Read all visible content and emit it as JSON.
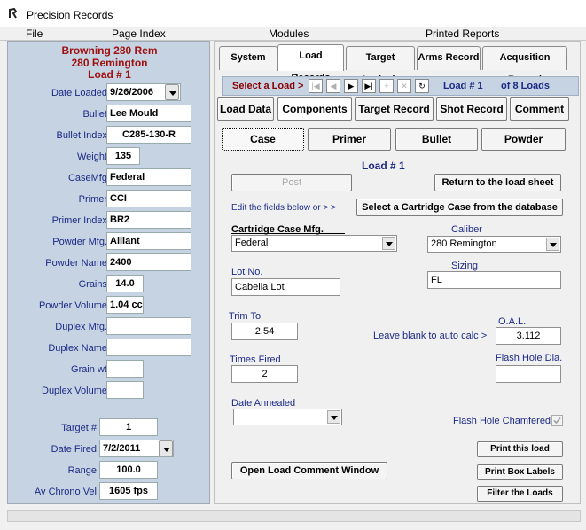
{
  "window": {
    "title": "Precision Records"
  },
  "menu": [
    "File",
    "Page Index",
    "Modules",
    "Printed Reports"
  ],
  "left": {
    "heading1": "Browning 280 Rem",
    "heading2": "280 Remington",
    "heading3": "Load #  1",
    "fields": {
      "date_loaded": {
        "label": "Date Loaded",
        "value": "9/26/2006"
      },
      "bullet": {
        "label": "Bullet",
        "value": "Lee Mould"
      },
      "bullet_index": {
        "label": "Bullet Index",
        "value": "C285-130-R"
      },
      "weight": {
        "label": "Weight",
        "value": "135"
      },
      "casemfg": {
        "label": "CaseMfg",
        "value": "Federal"
      },
      "primer": {
        "label": "Primer",
        "value": "CCI"
      },
      "primer_index": {
        "label": "Primer Index",
        "value": "BR2"
      },
      "powder_mfg": {
        "label": "Powder Mfg.",
        "value": "Alliant"
      },
      "powder_name": {
        "label": "Powder Name",
        "value": "2400"
      },
      "grains": {
        "label": "Grains",
        "value": "14.0"
      },
      "powder_volume": {
        "label": "Powder Volume",
        "value": "1.04 cc"
      },
      "duplex_mfg": {
        "label": "Duplex Mfg.",
        "value": ""
      },
      "duplex_name": {
        "label": "Duplex Name",
        "value": ""
      },
      "grain_wt": {
        "label": "Grain wt",
        "value": ""
      },
      "duplex_volume": {
        "label": "Duplex Volume",
        "value": ""
      },
      "target": {
        "label": "Target #",
        "value": "1"
      },
      "date_fired": {
        "label": "Date Fired",
        "value": "7/2/2011"
      },
      "range": {
        "label": "Range",
        "value": "100.0"
      },
      "av_chrono": {
        "label": "Av Chrono Vel",
        "value": "1605 fps"
      }
    }
  },
  "tabs": [
    "System",
    "Load Records",
    "Target Analysis",
    "Arms Record",
    "Acqusition Record"
  ],
  "select_bar": {
    "label": "Select a Load >",
    "load_text": "Load # 1",
    "of_text": "of 8  Loads",
    "nav": [
      "|◀",
      "◀",
      "▶",
      "▶|",
      "+",
      "✕",
      "↻"
    ]
  },
  "subtabs": [
    "Load Data",
    "Components",
    "Target Record",
    "Shot Record",
    "Comment"
  ],
  "component_tabs": [
    "Case",
    "Primer",
    "Bullet",
    "Powder"
  ],
  "case": {
    "load_heading": "Load #  1",
    "post_button": "Post",
    "return_button": "Return to the load sheet",
    "edit_hint": "Edit the fields below or > >",
    "select_case_button": "Select a Cartridge Case from the database",
    "case_mfg_label": "Cartridge Case Mfg.",
    "case_mfg_value": "Federal",
    "caliber_label": "Caliber",
    "caliber_value": "280 Remington",
    "lot_label": "Lot No.",
    "lot_value": "Cabella Lot",
    "sizing_label": "Sizing",
    "sizing_value": "FL",
    "trim_label": "Trim To",
    "trim_value": "2.54",
    "oal_label": "O.A.L.",
    "oal_hint": "Leave blank to auto calc >",
    "oal_value": "3.112",
    "times_fired_label": "Times Fired",
    "times_fired_value": "2",
    "flash_dia_label": "Flash Hole Dia.",
    "flash_dia_value": "",
    "annealed_label": "Date Annealed",
    "annealed_value": "",
    "chamfered_label": "Flash Hole Chamfered",
    "chamfered_checked": true,
    "open_comment_button": "Open Load Comment Window",
    "print_load_button": "Print this load",
    "print_box_button": "Print Box Labels",
    "filter_button": "Filter the Loads"
  },
  "colors": {
    "panel_bg": "#c5d3e2",
    "label_blue": "#1c2a86",
    "heading_red": "#a01010",
    "select_red": "#8b0000"
  }
}
